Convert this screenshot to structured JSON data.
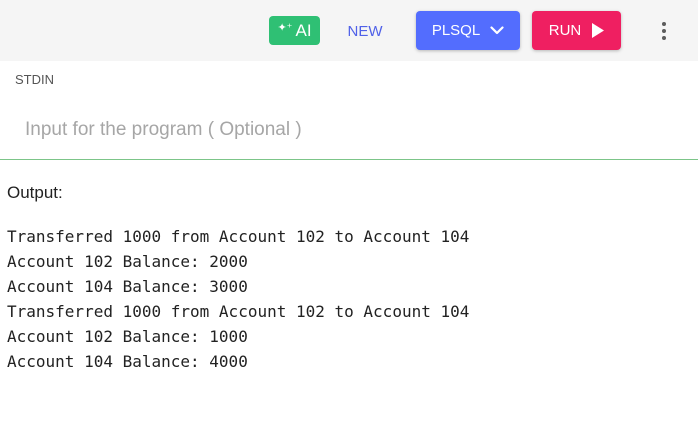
{
  "toolbar": {
    "ai_label": "AI",
    "new_label": "NEW",
    "language_label": "PLSQL",
    "run_label": "RUN"
  },
  "icons": {
    "ai": "sparkle-icon",
    "language": "chevron-down-icon",
    "run": "play-icon",
    "more": "kebab-menu-icon"
  },
  "colors": {
    "ai_button": "#2fc074",
    "new_text": "#5061e8",
    "language_button": "#536dfe",
    "run_button": "#ef1f61",
    "input_underline": "#7cc589"
  },
  "stdin": {
    "label": "STDIN",
    "value": "",
    "placeholder": "Input for the program ( Optional )"
  },
  "output": {
    "label": "Output:",
    "lines": [
      "Transferred 1000 from Account 102 to Account 104",
      "Account 102 Balance: 2000",
      "Account 104 Balance: 3000",
      "Transferred 1000 from Account 102 to Account 104",
      "Account 102 Balance: 1000",
      "Account 104 Balance: 4000"
    ]
  }
}
